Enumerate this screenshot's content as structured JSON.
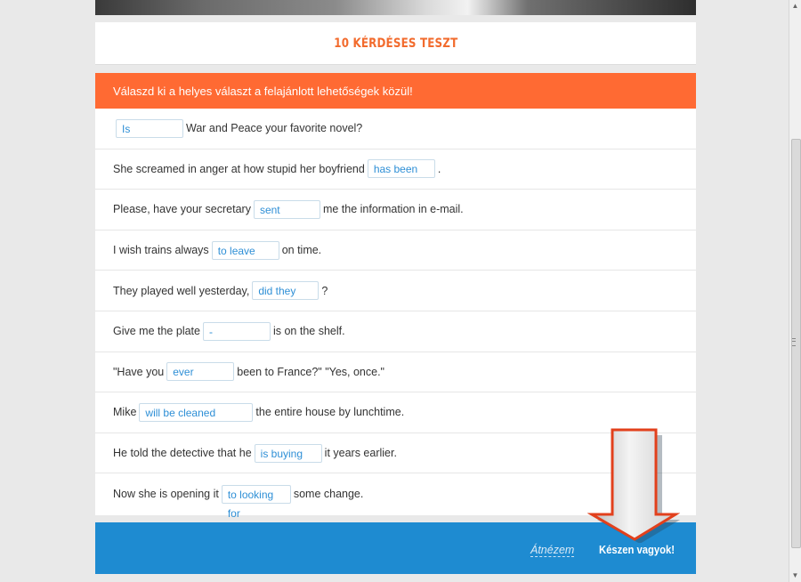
{
  "header": {
    "title": "10 KÉRDÉSES TESZT"
  },
  "instructions": "Válaszd ki a helyes választ a felajánlott lehetőségek közül!",
  "questions": [
    {
      "before": "",
      "answer": "Is",
      "after": "War and Peace your favorite novel?"
    },
    {
      "before": "She screamed in anger at how stupid her boyfriend",
      "answer": "has been",
      "after": "."
    },
    {
      "before": "Please, have your secretary",
      "answer": "sent",
      "after": "me the information in e-mail."
    },
    {
      "before": "I wish trains always",
      "answer": "to leave",
      "after": "on time."
    },
    {
      "before": "They played well yesterday,",
      "answer": "did they",
      "after": "?"
    },
    {
      "before": "Give me the plate",
      "answer": "-",
      "after": "is on the shelf."
    },
    {
      "before": "\"Have you",
      "answer": "ever",
      "after": "been to France?\" \"Yes, once.\""
    },
    {
      "before": "Mike",
      "answer": "will be cleaned",
      "after": "the entire house by lunchtime."
    },
    {
      "before": "He told the detective that he",
      "answer": "is buying",
      "after": "it years earlier."
    },
    {
      "before": "Now she is opening it",
      "answer": "to looking for",
      "after": "some change."
    }
  ],
  "footer": {
    "review_label": "Átnézem",
    "done_label": "Készen vagyok!"
  },
  "colors": {
    "accent_orange": "#ff6a33",
    "title_orange": "#f26b2d",
    "footer_blue": "#1e8bd1",
    "answer_blue": "#2e8fd6",
    "arrow_red": "#e2401c"
  },
  "icons": {
    "arrow": "down-arrow-icon"
  }
}
